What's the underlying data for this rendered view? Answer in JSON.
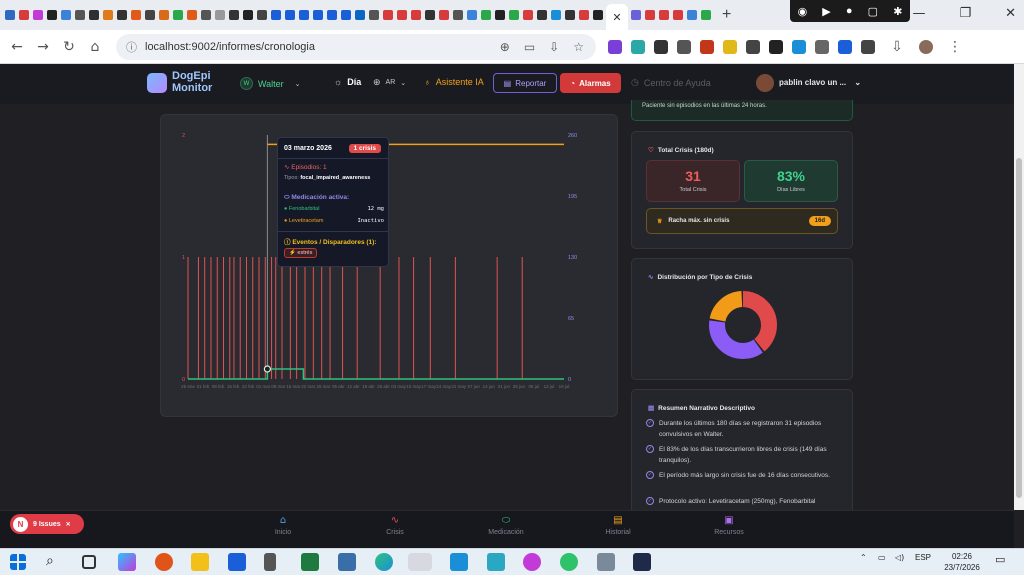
{
  "browser": {
    "url": "localhost:9002/informes/cronologia",
    "tab_close": "✕",
    "new_tab": "+",
    "window_controls": [
      "—",
      "❐",
      "✕"
    ]
  },
  "header": {
    "logo_line1": "DogEpi",
    "logo_line2": "Monitor",
    "pet_initial": "W",
    "pet_name": "Walter",
    "theme_label": "Día",
    "lang_label": "AR",
    "assistant_label": "Asistente IA",
    "report_label": "Reportar",
    "alarms_label": "Alarmas",
    "help_label": "Centro de Ayuda",
    "user_name": "pablin clavo un ..."
  },
  "status_banner": {
    "text": "Paciente sin episodios en las últimas 24 horas."
  },
  "chart_data": {
    "type": "bar",
    "left_axis_ticks": [
      "0",
      "1",
      "2"
    ],
    "right_axis_ticks": [
      "0",
      "65",
      "130",
      "195",
      "260"
    ],
    "x_tick_labels": [
      "25 ene",
      "01 feb",
      "08 feb",
      "15 feb",
      "22 feb",
      "01 mar",
      "08 mar",
      "15 mar",
      "22 mar",
      "29 mar",
      "05 abr",
      "12 abr",
      "19 abr",
      "26 abr",
      "03 may",
      "10 may",
      "17 may",
      "24 may",
      "31 may",
      "07 jun",
      "14 jun",
      "21 jun",
      "28 jun",
      "05 jul",
      "12 jul",
      "19 jul"
    ],
    "series": [
      {
        "kind": "crisis",
        "color": "#e05252",
        "values_at_days": [
          0,
          5,
          8,
          11,
          14,
          17,
          20,
          22,
          25,
          28,
          31,
          34,
          37,
          40,
          42,
          45,
          49,
          52,
          56,
          60,
          64,
          68,
          74,
          81,
          92,
          101,
          108,
          116,
          128,
          148,
          160
        ]
      },
      {
        "kind": "medication",
        "color": "#f2a019",
        "level": 250
      },
      {
        "kind": "medication",
        "color": "#2ec27e",
        "level": 12
      }
    ],
    "highlight_day": 38
  },
  "tooltip": {
    "date": "03 marzo 2026",
    "badge": "1 crisis",
    "episodes_label": "Episodios: 1",
    "types_label": "Tipos:",
    "types_value": "focal_impaired_awareness",
    "med_title": "Medicación activa:",
    "meds": [
      {
        "name": "Fenobarbital",
        "value": "12 mg",
        "color": "#2ec27e"
      },
      {
        "name": "Levetiracetam",
        "value": "Inactivo",
        "color": "#f2a019"
      }
    ],
    "events_title": "Eventos / Disparadores (1):",
    "event_tag": "estrés"
  },
  "total_card": {
    "title": "Total Crisis (180d)",
    "total_value": "31",
    "total_label": "Total Crisis",
    "free_value": "83%",
    "free_label": "Días Libres",
    "streak_label": "Racha máx. sin crisis",
    "streak_value": "16d"
  },
  "distribution_card": {
    "title": "Distribución por Tipo de Crisis",
    "slices": [
      {
        "value": 40,
        "color": "#e04a4a"
      },
      {
        "value": 38,
        "color": "#8b5cf6"
      },
      {
        "value": 22,
        "color": "#f29b19"
      }
    ]
  },
  "narrative_card": {
    "title": "Resumen Narrativo Descriptivo",
    "items": [
      "Durante los últimos 180 días se registraron 31 episodios convulsivos en Walter.",
      "El 83% de los días transcurrieron libres de crisis (149 días tranquilos).",
      "El período más largo sin crisis fue de 16 días consecutivos.",
      "Protocolo activo: Levetiracetam (250mg), Fenobarbital"
    ]
  },
  "bottom_nav": [
    {
      "label": "Inicio",
      "icon": "⌂",
      "color": "#4aa3df"
    },
    {
      "label": "Crisis",
      "icon": "∿",
      "color": "#e05252"
    },
    {
      "label": "Medicación",
      "icon": "⬭",
      "color": "#2ec27e"
    },
    {
      "label": "Historial",
      "icon": "▤",
      "color": "#f2a019"
    },
    {
      "label": "Recursos",
      "icon": "▣",
      "color": "#b06ff0"
    }
  ],
  "issues": {
    "initial": "N",
    "label": "9 Issues",
    "close": "✕"
  },
  "taskbar": {
    "lang": "ESP",
    "time": "02:26",
    "date": "23/7/2026"
  }
}
